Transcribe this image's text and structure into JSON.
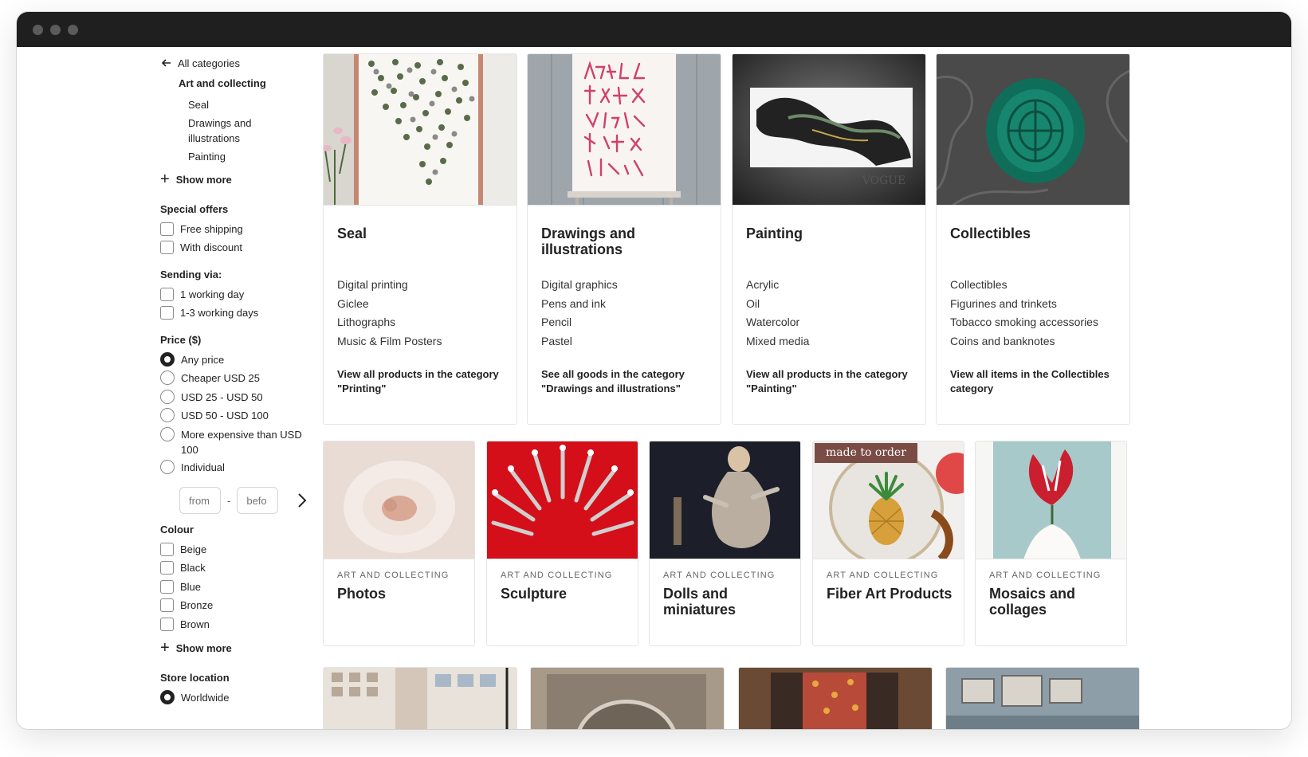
{
  "window": {
    "controls": [
      "close",
      "minimize",
      "maximize"
    ]
  },
  "sidebar": {
    "back_label": "All categories",
    "current_category": "Art and collecting",
    "subcategories": [
      "Seal",
      "Drawings and illustrations",
      "Painting"
    ],
    "show_more_1": "Show more",
    "special_offers": {
      "title": "Special offers",
      "options": [
        "Free shipping",
        "With discount"
      ]
    },
    "sending": {
      "title": "Sending via:",
      "options": [
        "1 working day",
        "1-3 working days"
      ]
    },
    "price": {
      "title": "Price ($)",
      "options": [
        "Any price",
        "Cheaper USD 25",
        "USD 25 - USD 50",
        "USD 50 - USD 100",
        "More expensive than USD 100",
        "Individual"
      ],
      "selected": "Any price",
      "from_placeholder": "from",
      "to_placeholder": "befo",
      "separator": "-"
    },
    "colour": {
      "title": "Colour",
      "options": [
        "Beige",
        "Black",
        "Blue",
        "Bronze",
        "Brown"
      ]
    },
    "show_more_2": "Show more",
    "store_location": {
      "title": "Store location",
      "options": [
        "Worldwide"
      ],
      "selected": "Worldwide"
    }
  },
  "categories": [
    {
      "title": "Seal",
      "links": [
        "Digital printing",
        "Giclee",
        "Lithographs",
        "Music & Film Posters"
      ],
      "view_all": "View all products in the category \"Printing\""
    },
    {
      "title": "Drawings and illustrations",
      "links": [
        "Digital graphics",
        "Pens and ink",
        "Pencil",
        "Pastel"
      ],
      "view_all": "See all goods in the category \"Drawings and illustrations\""
    },
    {
      "title": "Painting",
      "links": [
        "Acrylic",
        "Oil",
        "Watercolor",
        "Mixed media"
      ],
      "view_all": "View all products in the category \"Painting\""
    },
    {
      "title": "Collectibles",
      "links": [
        "Collectibles",
        "Figurines and trinkets",
        "Tobacco smoking accessories",
        "Coins and banknotes"
      ],
      "view_all": "View all items in the Collectibles category"
    }
  ],
  "subcategory_cards": [
    {
      "kicker": "ART AND COLLECTING",
      "title": "Photos"
    },
    {
      "kicker": "ART AND COLLECTING",
      "title": "Sculpture"
    },
    {
      "kicker": "ART AND COLLECTING",
      "title": "Dolls and miniatures"
    },
    {
      "kicker": "ART AND COLLECTING",
      "title": "Fiber Art Products",
      "badge": "made to order"
    },
    {
      "kicker": "ART AND COLLECTING",
      "title": "Mosaics and collages"
    }
  ],
  "image_text": {
    "painting_caption": "VOGUE"
  },
  "colors": {
    "titlebar": "#1f1f1f",
    "badge": "#7a4c45",
    "sculpture_bg": "#d40f1a"
  }
}
